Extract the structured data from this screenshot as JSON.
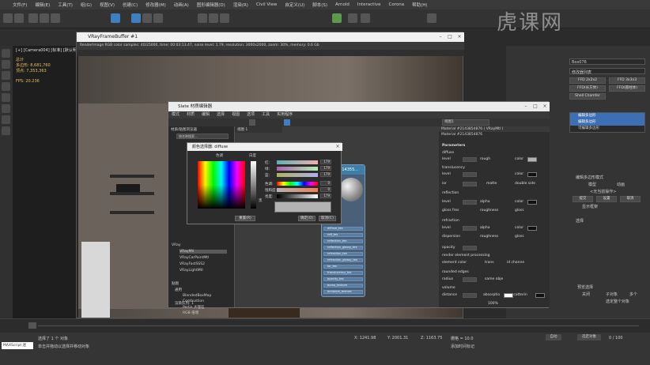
{
  "menubar": {
    "items": [
      "文件(F)",
      "编辑(E)",
      "工具(T)",
      "组(G)",
      "视图(V)",
      "创建(C)",
      "修改器(M)",
      "动画(A)",
      "图形编辑器(D)",
      "渲染(R)",
      "Civil View",
      "自定义(U)",
      "脚本(S)",
      "Arnold",
      "Interactive",
      "Corona",
      "帮助(H)"
    ]
  },
  "watermark": {
    "text": "虎课网"
  },
  "viewport": {
    "label": "[+] [Camera004] [标准] [默认明暗处理]",
    "stats": [
      "总计",
      "多边形: 8,681,760",
      "顶点: 7,353,363",
      "FPS: 20.236"
    ]
  },
  "frame_buffer": {
    "title": "VRayFrameBuffer #1",
    "toolbar": "RenderImage   RGB color        samples: 40/25000,  time: 00:03:13.47,  noise level: 1.79,  resolution: 3000x2000,  zoom: 30%,  memory: 0.6 Gb"
  },
  "slate_editor": {
    "title": "Slate 材质编辑器",
    "menu": [
      "模式",
      "材质",
      "编辑",
      "选择",
      "视图",
      "选项",
      "工具",
      "实用程序"
    ],
    "browser_title": "材质/贴图浏览器",
    "search_placeholder": "按名称搜索...",
    "view_tab": "视图1",
    "browser_items": [
      "VRay",
      "VRayMtl",
      "VRayCarPaintMtl",
      "VRayFastSSS2",
      "VRayLightMtl",
      "贴图",
      "通用",
      "BlendedBoxMap",
      "Combustion",
      "Perlin 大理石",
      "RGB 倍增"
    ],
    "view_label": "视图 1",
    "material_header": "Material #2143854876  ( VRayMtl )",
    "material_name": "Material #2143854876",
    "params": {
      "section": "Parameters",
      "rows": [
        {
          "label": "diffuse"
        },
        {
          "label": "level",
          "v1": "1.0",
          "l2": "rough",
          "v2": "0.0",
          "l3": "color"
        },
        {
          "label": "translucency"
        },
        {
          "label": "level",
          "v1": "0.0",
          "l2": "color"
        },
        {
          "label": "ior",
          "v1": "1.6",
          "l2": "matte",
          "l3": "double side"
        },
        {
          "label": "reflection"
        },
        {
          "label": "level",
          "v1": "0.0",
          "l2": "alpha",
          "v2": "1.0",
          "l3": "color"
        },
        {
          "label": "gloss  fres",
          "l2": "roughness",
          "v2": "0.0",
          "l3": "gloss"
        },
        {
          "label": "refraction"
        },
        {
          "label": "level",
          "v1": "0.0",
          "l2": "alpha",
          "v2": "1.0",
          "l3": "color"
        },
        {
          "label": "dispersion",
          "v1": "0.0",
          "l2": "roughness",
          "v2": "0.0",
          "l3": "gloss"
        },
        {
          "label": "opacity",
          "v1": "1.0"
        },
        {
          "label": "render element processing"
        },
        {
          "label": "element color",
          "l2": "trans",
          "l3": "id channe"
        },
        {
          "label": "rounded edges"
        },
        {
          "label": "radius",
          "v1": "0.0",
          "l2": "same obje"
        },
        {
          "label": "volume"
        },
        {
          "label": "distance",
          "v1": "1.0",
          "l2": "absorptio",
          "l3": "scatterin"
        }
      ],
      "zoom": "100%"
    },
    "node": {
      "title": "#214355...",
      "slots": [
        "diffuse_tex",
        "refl_tex",
        "reflection_tex",
        "reflection_glossy_tex",
        "refraction_tex",
        "refraction_glossy_tex",
        "ior_tex",
        "translucency_tex",
        "opacity_tex",
        "bump_texture",
        "emissive_texture"
      ]
    },
    "status": "渲染队列: 1"
  },
  "color_picker": {
    "title": "颜色选择器: diffuse",
    "hue_label": "色调",
    "white_label": "白度",
    "black_label": "黑",
    "channels": [
      {
        "label": "红:",
        "value": "179"
      },
      {
        "label": "绿:",
        "value": "179"
      },
      {
        "label": "蓝:",
        "value": "179"
      },
      {
        "label": "色调:",
        "value": "0"
      },
      {
        "label": "饱和度:",
        "value": "0"
      },
      {
        "label": "亮度:",
        "value": "179"
      }
    ],
    "reset_btn": "重置(R)",
    "ok_btn": "确定(O)",
    "cancel_btn": "取消(C)"
  },
  "right_panel": {
    "object_name": "Box076",
    "modifier_list": "修改器列表",
    "buttons": [
      "FFD 2x2x2",
      "FFD 3x3x3",
      "FFD(长方体)",
      "FFD(圆柱体)",
      "Shell Chamfer"
    ],
    "stack": [
      "编辑多边形",
      "编辑多边形",
      "可编辑多边形"
    ],
    "section_edit": "编辑多边形模式",
    "model_label": "模型",
    "anim_label": "动画",
    "no_op": "<无当前操作>",
    "commit": "提交",
    "settings": "设置",
    "cancel": "取消",
    "show_cage": "显示框架",
    "section_select": "选择",
    "preview_sel": "预览选择",
    "off": "关闭",
    "subobj": "子对象",
    "multi": "多个",
    "selected": "选定整个对象"
  },
  "status": {
    "selected": "选择了 1 个 对象",
    "hint": "单击并拖动以选择并移动对象",
    "maxscript": "MAXScript 迷",
    "x": "X: 1241.98",
    "y": "Y: 2001.31",
    "z": "Z: 1163.75",
    "grid": "栅格 = 10.0",
    "add_tag": "添加时间标记",
    "autokey": "自动",
    "selected_btn": "选定对象",
    "frame": "0 / 100"
  }
}
